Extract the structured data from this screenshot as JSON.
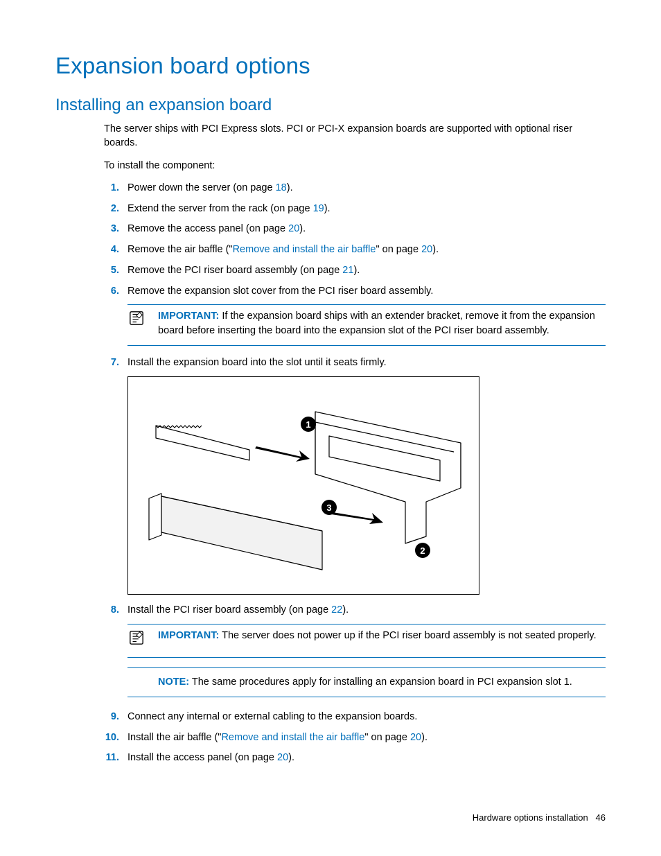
{
  "h1": "Expansion board options",
  "h2": "Installing an expansion board",
  "intro1": "The server ships with PCI Express slots. PCI or PCI-X expansion boards are supported with optional riser boards.",
  "intro2": "To install the component:",
  "steps": {
    "s1": {
      "num": "1.",
      "a": "Power down the server (on page ",
      "link": "18",
      "b": ")."
    },
    "s2": {
      "num": "2.",
      "a": "Extend the server from the rack (on page ",
      "link": "19",
      "b": ")."
    },
    "s3": {
      "num": "3.",
      "a": "Remove the access panel (on page ",
      "link": "20",
      "b": ")."
    },
    "s4": {
      "num": "4.",
      "a": "Remove the air baffle (\"",
      "link1": "Remove and install the air baffle",
      "mid": "\" on page ",
      "link2": "20",
      "b": ")."
    },
    "s5": {
      "num": "5.",
      "a": "Remove the PCI riser board assembly (on page ",
      "link": "21",
      "b": ")."
    },
    "s6": {
      "num": "6.",
      "text": "Remove the expansion slot cover from the PCI riser board assembly."
    },
    "s7": {
      "num": "7.",
      "text": "Install the expansion board into the slot until it seats firmly."
    },
    "s8": {
      "num": "8.",
      "a": "Install the PCI riser board assembly (on page ",
      "link": "22",
      "b": ")."
    },
    "s9": {
      "num": "9.",
      "text": "Connect any internal or external cabling to the expansion boards."
    },
    "s10": {
      "num": "10.",
      "a": "Install the air baffle (\"",
      "link1": "Remove and install the air baffle",
      "mid": "\" on page ",
      "link2": "20",
      "b": ")."
    },
    "s11": {
      "num": "11.",
      "a": "Install the access panel (on page ",
      "link": "20",
      "b": ")."
    }
  },
  "important1": {
    "label": "IMPORTANT:",
    "text": " If the expansion board ships with an extender bracket, remove it from the expansion board before inserting the board into the expansion slot of the PCI riser board assembly."
  },
  "important2": {
    "label": "IMPORTANT:",
    "text": " The server does not power up if the PCI riser board assembly is not seated properly."
  },
  "note1": {
    "label": "NOTE:",
    "text": " The same procedures apply for installing an expansion board in PCI expansion slot 1."
  },
  "figure": {
    "callouts": [
      "1",
      "2",
      "3"
    ]
  },
  "footer": {
    "section": "Hardware options installation",
    "page": "46"
  }
}
